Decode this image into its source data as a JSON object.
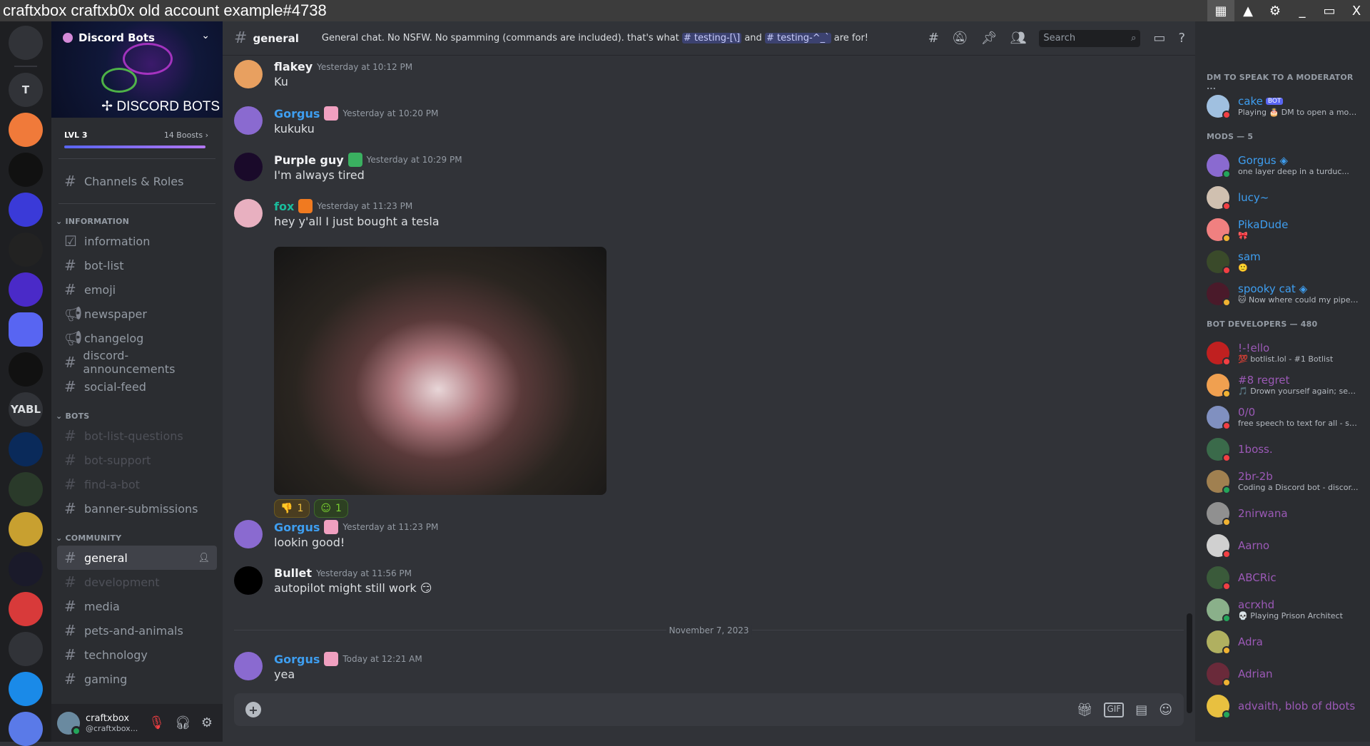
{
  "window": {
    "title": "craftxbox craftxb0x old account example#4738",
    "controls": [
      "apps-grid-icon",
      "triangle-icon",
      "gear-icon",
      "minimize-icon",
      "maximize-icon",
      "close-icon"
    ],
    "close_label": "X",
    "minimize_label": "_"
  },
  "servers": [
    {
      "icon": "discord-home-icon",
      "color": "#313338"
    },
    {
      "label": "T",
      "color": "#313338"
    },
    {
      "icon": "taws-server-icon",
      "color": "#f07a3a"
    },
    {
      "icon": "bike-server-icon",
      "color": "#111"
    },
    {
      "icon": "pixel-server-icon",
      "color": "#3a3ad8"
    },
    {
      "icon": "u-server-icon",
      "color": "#222"
    },
    {
      "icon": "pr-server-icon",
      "color": "#4a2ac8"
    },
    {
      "icon": "discord-bots-server-icon",
      "color": "#313338"
    },
    {
      "icon": "void-star-server-icon",
      "color": "#111"
    },
    {
      "label": "YABL",
      "color": "#313338"
    },
    {
      "icon": "lambda-server-icon",
      "color": "#0a2a5a"
    },
    {
      "icon": "monster-station-server-icon",
      "color": "#2a3a2a"
    },
    {
      "icon": "hrcc-server-icon",
      "color": "#c8a030"
    },
    {
      "icon": "arrow-server-icon",
      "color": "#1a1a2a"
    },
    {
      "icon": "comic-server-icon",
      "color": "#d83a3a"
    },
    {
      "icon": "toolbox-server-icon",
      "color": "#313338"
    },
    {
      "icon": "blue-circle-server-icon",
      "color": "#1a8ae8"
    },
    {
      "icon": "mug-server-icon",
      "color": "#5a7ae8"
    }
  ],
  "sidebar": {
    "server_name": "Discord Bots",
    "banner_text": "DISCORD BOTS",
    "level": "LVL 3",
    "boosts": "14 Boosts",
    "boost_progress": 0.98,
    "channels_roles": "Channels & Roles",
    "categories": [
      {
        "name": "INFORMATION",
        "channels": [
          {
            "name": "information",
            "icon": "rules-icon"
          },
          {
            "name": "bot-list",
            "icon": "hash-icon"
          },
          {
            "name": "emoji",
            "icon": "hash-icon"
          },
          {
            "name": "newspaper",
            "icon": "megaphone-icon"
          },
          {
            "name": "changelog",
            "icon": "megaphone-icon"
          },
          {
            "name": "discord-announcements",
            "icon": "hash-icon"
          },
          {
            "name": "social-feed",
            "icon": "hash-icon"
          }
        ]
      },
      {
        "name": "BOTS",
        "channels": [
          {
            "name": "bot-list-questions",
            "icon": "hash-icon",
            "muted": true
          },
          {
            "name": "bot-support",
            "icon": "hash-icon",
            "muted": true
          },
          {
            "name": "find-a-bot",
            "icon": "hash-icon",
            "muted": true
          },
          {
            "name": "banner-submissions",
            "icon": "hash-icon"
          }
        ]
      },
      {
        "name": "COMMUNITY",
        "channels": [
          {
            "name": "general",
            "icon": "hash-thread-icon",
            "selected": true
          },
          {
            "name": "development",
            "icon": "hash-icon",
            "muted": true
          },
          {
            "name": "media",
            "icon": "hash-icon"
          },
          {
            "name": "pets-and-animals",
            "icon": "hash-icon"
          },
          {
            "name": "technology",
            "icon": "hash-icon"
          },
          {
            "name": "gaming",
            "icon": "hash-icon"
          }
        ]
      }
    ],
    "user": {
      "name": "craftxbox",
      "handle": "@craftxbox...",
      "status": "online"
    }
  },
  "header": {
    "channel": "general",
    "topic_pre": "General chat. No NSFW. No spamming (commands are included). that's what",
    "mention1": "testing-[\\]",
    "topic_mid": "and",
    "mention2": "testing-^_`",
    "topic_post": "are for!",
    "search_placeholder": "Search"
  },
  "messages": [
    {
      "author": "flakey",
      "color": "#f2f3f5",
      "time": "Yesterday at 10:12 PM",
      "text": "Ku",
      "avatar": "#e8a060"
    },
    {
      "author": "Gorgus",
      "color": "#3e9ef0",
      "time": "Yesterday at 10:20 PM",
      "text": "kukuku",
      "avatar": "#8a6ad0",
      "badge": "#f0a0c0"
    },
    {
      "author": "Purple guy",
      "color": "#f2f3f5",
      "time": "Yesterday at 10:29 PM",
      "text": "I'm always tired",
      "avatar": "#1a0a2a",
      "badge": "#3ab060"
    },
    {
      "author": "fox",
      "color": "#1abc9c",
      "time": "Yesterday at 11:23 PM",
      "text": "hey y'all I just bought a tesla",
      "avatar": "#e8b0c0",
      "badge": "#f07a20"
    },
    {
      "author": "Gorgus",
      "color": "#3e9ef0",
      "time": "Yesterday at 11:23 PM",
      "text": "lookin good!",
      "avatar": "#8a6ad0",
      "badge": "#f0a0c0"
    },
    {
      "author": "Bullet",
      "color": "#f2f3f5",
      "time": "Yesterday at 11:56 PM",
      "text": "autopilot might still work 😏",
      "avatar": "#000"
    },
    {
      "author": "Gorgus",
      "color": "#3e9ef0",
      "time": "Today at 12:21 AM",
      "text": "yea",
      "avatar": "#8a6ad0",
      "badge": "#f0a0c0"
    }
  ],
  "reactions": [
    {
      "emoji": "👎",
      "count": "1",
      "bg": "#4a3d20",
      "border": "#6b5a20",
      "color": "#f0c040"
    },
    {
      "emoji": "☺",
      "count": "1",
      "bg": "#2d4022",
      "border": "#3e6a2a",
      "color": "#7ad030"
    }
  ],
  "date_divider": "November 7, 2023",
  "members": [
    {
      "section": "DM TO SPEAK TO A MODERATOR ...",
      "items": [
        {
          "name": "cake",
          "bot": "BOT",
          "sub": "Playing 🎂 DM to open a mod...",
          "color": "#3e9ef0",
          "status": "dnd",
          "avatar": "#a0c0e0"
        }
      ]
    },
    {
      "section": "MODS — 5",
      "items": [
        {
          "name": "Gorgus ◈",
          "sub": "one layer deep in a turduc...",
          "color": "#3e9ef0",
          "status": "online",
          "avatar": "#8a6ad0"
        },
        {
          "name": "lucy~",
          "color": "#3e9ef0",
          "status": "dnd",
          "avatar": "#d0c0b0"
        },
        {
          "name": "PikaDude",
          "sub": "🎀",
          "color": "#3e9ef0",
          "status": "idle",
          "avatar": "#f08080"
        },
        {
          "name": "sam",
          "sub": "🙂",
          "color": "#3e9ef0",
          "status": "dnd",
          "avatar": "#3a4a2a"
        },
        {
          "name": "spooky cat ◈",
          "sub": "🐱 Now where could my pipe ...",
          "color": "#3e9ef0",
          "status": "idle",
          "avatar": "#4a1a2a"
        }
      ]
    },
    {
      "section": "BOT DEVELOPERS — 480",
      "items": [
        {
          "name": "!-!ello",
          "sub": "💯 botlist.lol - #1 Botlist",
          "color": "#9b59b6",
          "status": "dnd",
          "avatar": "#c02020"
        },
        {
          "name": "#8 regret",
          "sub": "🎵 Drown yourself again; see i...",
          "color": "#9b59b6",
          "status": "idle",
          "avatar": "#f0a050"
        },
        {
          "name": "0/0",
          "sub": "free speech to text for all - sc...",
          "color": "#9b59b6",
          "status": "dnd",
          "avatar": "#8090c0"
        },
        {
          "name": "1boss.",
          "color": "#9b59b6",
          "status": "dnd",
          "avatar": "#3a6a4a"
        },
        {
          "name": "2br-2b",
          "sub": "Coding a Discord bot - discor...",
          "color": "#9b59b6",
          "status": "online",
          "avatar": "#a08050"
        },
        {
          "name": "2nirwana",
          "color": "#9b59b6",
          "status": "idle",
          "avatar": "#909090"
        },
        {
          "name": "Aarno",
          "color": "#9b59b6",
          "status": "dnd",
          "avatar": "#d0d0d0"
        },
        {
          "name": "ABCRic",
          "color": "#9b59b6",
          "status": "dnd",
          "avatar": "#3a5a3a"
        },
        {
          "name": "acrxhd",
          "sub": "💀 Playing Prison Architect",
          "color": "#9b59b6",
          "status": "online",
          "avatar": "#8ab08a"
        },
        {
          "name": "Adra",
          "color": "#9b59b6",
          "status": "idle",
          "avatar": "#b0b060"
        },
        {
          "name": "Adrian",
          "color": "#9b59b6",
          "status": "idle",
          "avatar": "#6a2a3a"
        },
        {
          "name": "advaith, blob of dbots",
          "color": "#9b59b6",
          "status": "online",
          "avatar": "#e8c040"
        }
      ]
    }
  ],
  "status_colors": {
    "online": "#23a55a",
    "dnd": "#f23f43",
    "idle": "#f0b232"
  }
}
